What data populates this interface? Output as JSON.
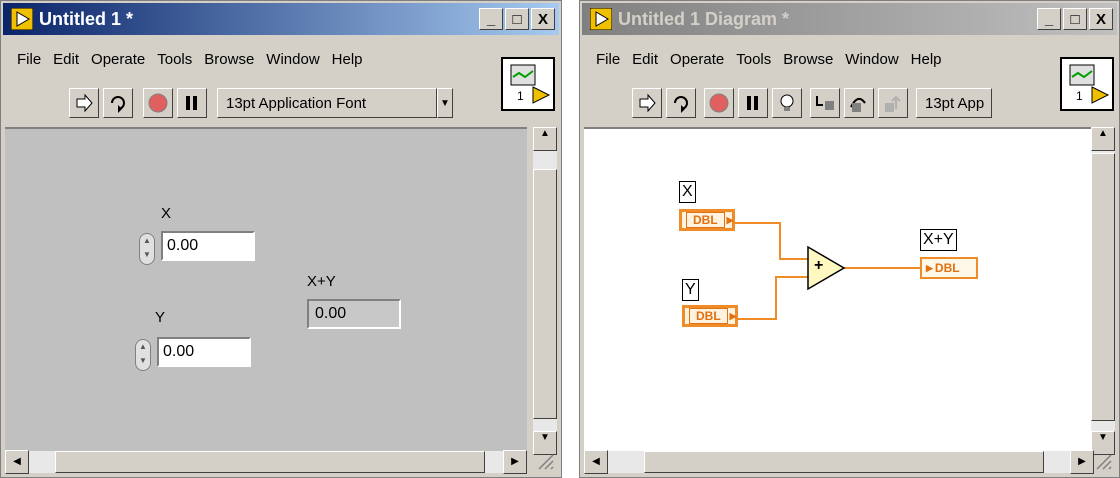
{
  "front_panel": {
    "title": "Untitled 1 *",
    "menu": [
      {
        "label": "File"
      },
      {
        "label": "Edit"
      },
      {
        "label": "Operate"
      },
      {
        "label": "Tools"
      },
      {
        "label": "Browse"
      },
      {
        "label": "Window"
      },
      {
        "label": "Help"
      }
    ],
    "font_selector": "13pt Application Font",
    "vi_icon_number": "1",
    "controls": {
      "x_label": "X",
      "x_value": "0.00",
      "y_label": "Y",
      "y_value": "0.00",
      "sum_label": "X+Y",
      "sum_value": "0.00"
    }
  },
  "diagram": {
    "title": "Untitled 1 Diagram *",
    "menu": [
      {
        "label": "File"
      },
      {
        "label": "Edit"
      },
      {
        "label": "Operate"
      },
      {
        "label": "Tools"
      },
      {
        "label": "Browse"
      },
      {
        "label": "Window"
      },
      {
        "label": "Help"
      }
    ],
    "font_selector": "13pt App",
    "vi_icon_number": "1",
    "terminals": {
      "x_label": "X",
      "y_label": "Y",
      "sum_label": "X+Y",
      "type": "DBL",
      "add_symbol": "+"
    }
  },
  "window_buttons": {
    "minimize": "_",
    "maximize": "□",
    "close": "X"
  },
  "colors": {
    "active_title": "#0a246a",
    "inactive_title": "#808080",
    "wire": "#f08c28",
    "panel_bg": "#c0c0c0"
  }
}
